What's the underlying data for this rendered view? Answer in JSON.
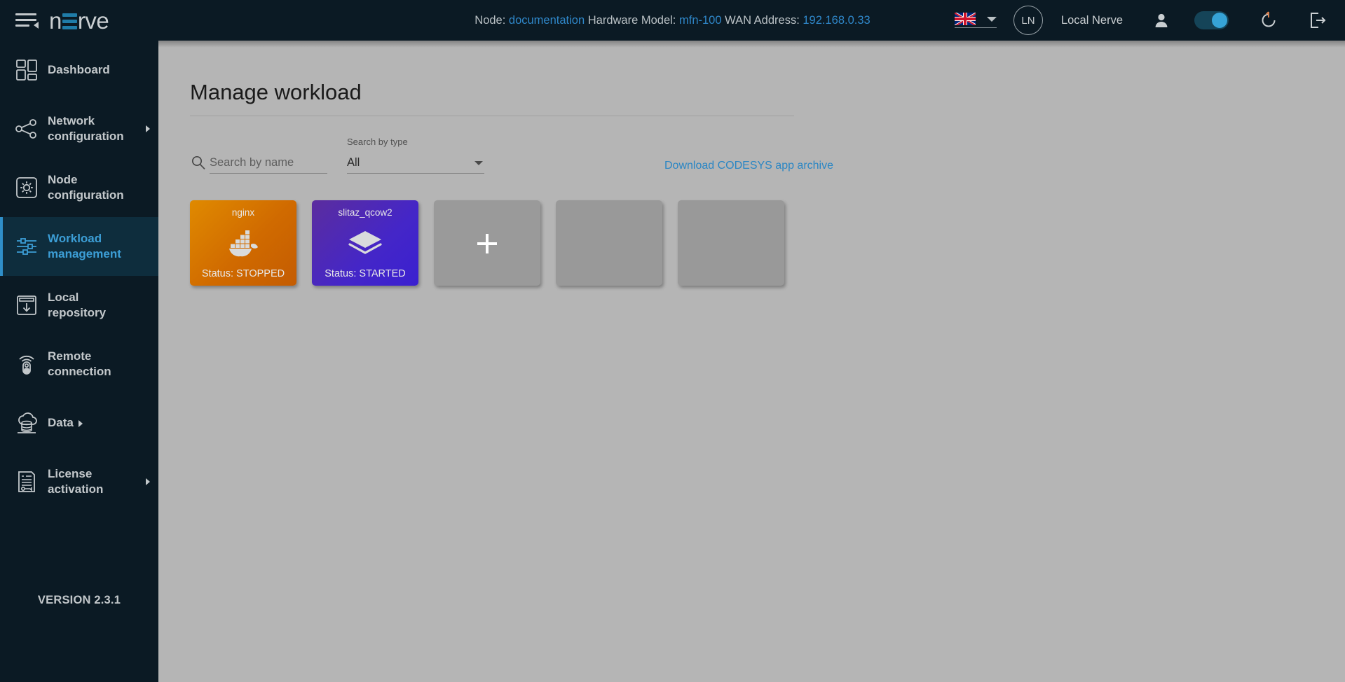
{
  "topbar": {
    "menu_icon": "hamburger-menu-icon",
    "brand": {
      "pre": "n",
      "post": "rve"
    },
    "status": {
      "node_label": "Node:",
      "node_value": "documentation",
      "hw_label": "Hardware Model:",
      "hw_value": "mfn-100",
      "wan_label": "WAN Address:",
      "wan_value": "192.168.0.33"
    },
    "language": "en-GB",
    "avatar_initials": "LN",
    "user_name": "Local Nerve",
    "icons": {
      "person": "person-icon",
      "toggle": "remote-connection-toggle",
      "reload": "restart-icon",
      "logout": "logout-icon"
    },
    "toggle_on": true,
    "colors": {
      "bar_bg": "#0b1a24",
      "accent": "#2f8fc9",
      "link": "#2f87c9"
    }
  },
  "sidebar": {
    "items": [
      {
        "label": "Dashboard",
        "icon": "dashboard-icon",
        "active": false,
        "expandable": false
      },
      {
        "label": "Network configuration",
        "icon": "network-icon",
        "active": false,
        "expandable": true
      },
      {
        "label": "Node configuration",
        "icon": "node-gear-icon",
        "active": false,
        "expandable": false
      },
      {
        "label": "Workload management",
        "icon": "sliders-icon",
        "active": true,
        "expandable": false
      },
      {
        "label": "Local repository",
        "icon": "repository-download-icon",
        "active": false,
        "expandable": false
      },
      {
        "label": "Remote connection",
        "icon": "remote-control-icon",
        "active": false,
        "expandable": false
      },
      {
        "label": "Data",
        "icon": "cloud-data-icon",
        "active": false,
        "expandable": false,
        "inline_arrow": true
      },
      {
        "label": "License activation",
        "icon": "license-document-icon",
        "active": false,
        "expandable": true
      }
    ],
    "version": "VERSION 2.3.1",
    "colors": {
      "bg": "#0b1a24",
      "active_bg": "#0e2d3d",
      "active_text": "#3c9ed6"
    }
  },
  "main": {
    "page_title": "Manage workload",
    "search": {
      "name_placeholder": "Search by name",
      "name_value": "",
      "icon": "search-icon",
      "type_label": "Search by type",
      "type_value": "All",
      "type_options": [
        "All"
      ]
    },
    "codesys_link": "Download CODESYS app archive",
    "cards": [
      {
        "name": "nginx",
        "status": "Status: STOPPED",
        "kind": "docker",
        "icon": "docker-whale-icon",
        "highlighted": false
      },
      {
        "name": "slitaz_qcow2",
        "status": "Status: STARTED",
        "kind": "vm",
        "icon": "vm-layers-icon",
        "highlighted": false
      },
      {
        "name": "",
        "status": "",
        "kind": "add",
        "icon": "plus-icon",
        "highlighted": true
      },
      {
        "name": "",
        "status": "",
        "kind": "blank",
        "icon": "",
        "highlighted": false
      },
      {
        "name": "",
        "status": "",
        "kind": "blank",
        "icon": "",
        "highlighted": false
      }
    ],
    "colors": {
      "bg": "#b5b5b5",
      "highlight_border": "#f4620a",
      "link": "#2a86c4"
    }
  }
}
